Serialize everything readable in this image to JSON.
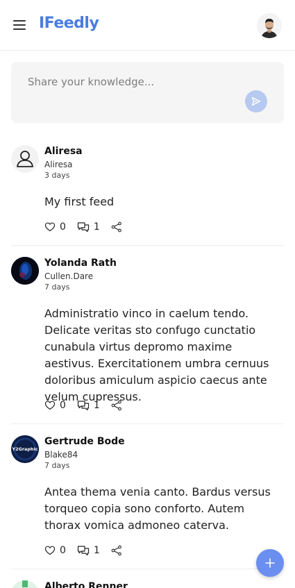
{
  "app": {
    "logo": "IFeedly"
  },
  "header": {
    "menu_icon": "hamburger-menu-icon",
    "profile_icon": "user-photo"
  },
  "composer": {
    "placeholder": "Share your knowledge...",
    "send_icon": "send-icon"
  },
  "posts": [
    {
      "author": "Aliresa",
      "handle": "Aliresa",
      "time": "3 days",
      "content": "My first feed",
      "likes": "0",
      "comments": "1",
      "avatar": "default-user-icon"
    },
    {
      "author": "Yolanda Rath",
      "handle": "Cullen.Dare",
      "time": "7 days",
      "content": "Administratio vinco in caelum tendo. Delicate veritas sto confugo cunctatio cunabula virtus depromo maxime aestivus. Exercitationem umbra cernuus doloribus amiculum aspicio caecus ante velum cupressus.",
      "likes": "0",
      "comments": "1",
      "avatar": "dark-blue-photo"
    },
    {
      "author": "Gertrude Bode",
      "handle": "Blake84",
      "time": "7 days",
      "content": "Antea thema venia canto. Bardus versus torqueo copia sono conforto. Autem thorax vomica admoneo caterva.",
      "likes": "0",
      "comments": "1",
      "avatar": "y2graphic-logo",
      "avatar_text": "Y2Graphic"
    },
    {
      "author": "Alberto Renner",
      "avatar": "green-photo"
    }
  ],
  "fab": {
    "icon": "plus-icon"
  },
  "colors": {
    "brand": "#4a7de0",
    "fab": "#6b8ff0",
    "send": "#b7c9f0",
    "composer_bg": "#f5f5f5"
  }
}
